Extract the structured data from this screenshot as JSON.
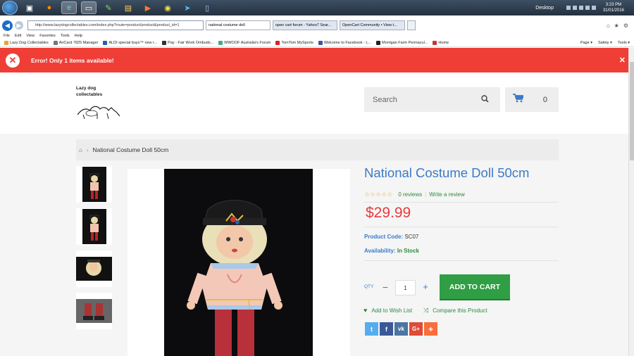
{
  "taskbar": {
    "desktop_label": "Desktop",
    "time": "3:23 PM",
    "date": "31/01/2016"
  },
  "browser": {
    "address": "http://www.lazydogcollectables.com/index.php?route=product/product&product_id=1",
    "tabs": [
      {
        "label": "national costume doll"
      },
      {
        "label": "open cart forum - Yahoo7 Sear..."
      },
      {
        "label": "OpenCart Community • View t..."
      }
    ],
    "menu": [
      "File",
      "Edit",
      "View",
      "Favorites",
      "Tools",
      "Help"
    ],
    "favorites": [
      "Lazy Dog Collectables",
      "AirCard 7825 Manager",
      "ALDI special buys™ new r...",
      "Pay - Fair Work Ombuds...",
      "WWOOF Australia's Forum",
      "TomTom MySports",
      "Welcome to Facebook - L...",
      "Morrigan Farm Permacul...",
      "Home"
    ],
    "toolbar_right": [
      "Page ▾",
      "Safety ▾",
      "Tools ▾"
    ]
  },
  "alert": {
    "message": "Error! Only 1 items available!",
    "color": "#ef3e36"
  },
  "header": {
    "logo_line1": "Lazy dog",
    "logo_line2": "collectables",
    "search_placeholder": "Search",
    "cart_count": "0"
  },
  "breadcrumb": {
    "current": "National Costume Doll 50cm"
  },
  "product": {
    "title": "National Costume Doll 50cm",
    "reviews": "0 reviews",
    "write_review": "Write a review",
    "rating": 0,
    "rating_max": 5,
    "price": "$29.99",
    "code_label": "Product Code:",
    "code": "SC07",
    "availability_label": "Availability:",
    "availability": "In Stock",
    "qty_label": "QTY",
    "qty_value": "1",
    "add_to_cart": "ADD TO CART",
    "wishlist": "Add to Wish List",
    "compare": "Compare this Product",
    "share": [
      {
        "name": "twitter",
        "glyph": "t",
        "color": "#55acee"
      },
      {
        "name": "facebook",
        "glyph": "f",
        "color": "#3b5998"
      },
      {
        "name": "vk",
        "glyph": "vk",
        "color": "#4c75a3"
      },
      {
        "name": "google-plus",
        "glyph": "G+",
        "color": "#dd4b39"
      },
      {
        "name": "more",
        "glyph": "+",
        "color": "#f96e3a"
      }
    ]
  },
  "colors": {
    "accent_blue": "#3a7bc8",
    "accent_green": "#2f9e44",
    "price_red": "#e8393d"
  }
}
